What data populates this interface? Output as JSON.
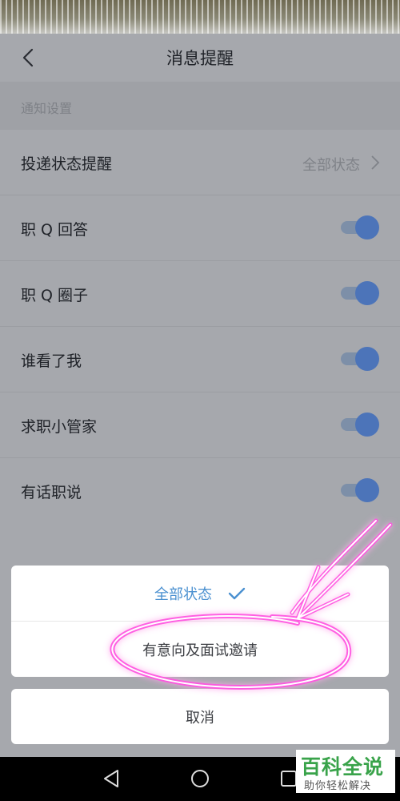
{
  "header": {
    "title": "消息提醒"
  },
  "section": {
    "title": "通知设置"
  },
  "rows": [
    {
      "label": "投递状态提醒",
      "value": "全部状态"
    },
    {
      "label": "职 Q 回答",
      "toggle": true
    },
    {
      "label": "职 Q 圈子",
      "toggle": true
    },
    {
      "label": "谁看了我",
      "toggle": true
    },
    {
      "label": "求职小管家",
      "toggle": true
    },
    {
      "label": "有话职说",
      "toggle": true
    }
  ],
  "sheet": {
    "options": [
      {
        "label": "全部状态",
        "selected": true
      },
      {
        "label": "有意向及面试邀请",
        "selected": false
      }
    ],
    "cancel_label": "取消"
  },
  "watermark": {
    "main": "百科全说",
    "sub": "助你轻松解决"
  },
  "colors": {
    "accent": "#4a90d0",
    "toggle_knob": "#4c74b9",
    "annotation": "#ff3fd8"
  }
}
